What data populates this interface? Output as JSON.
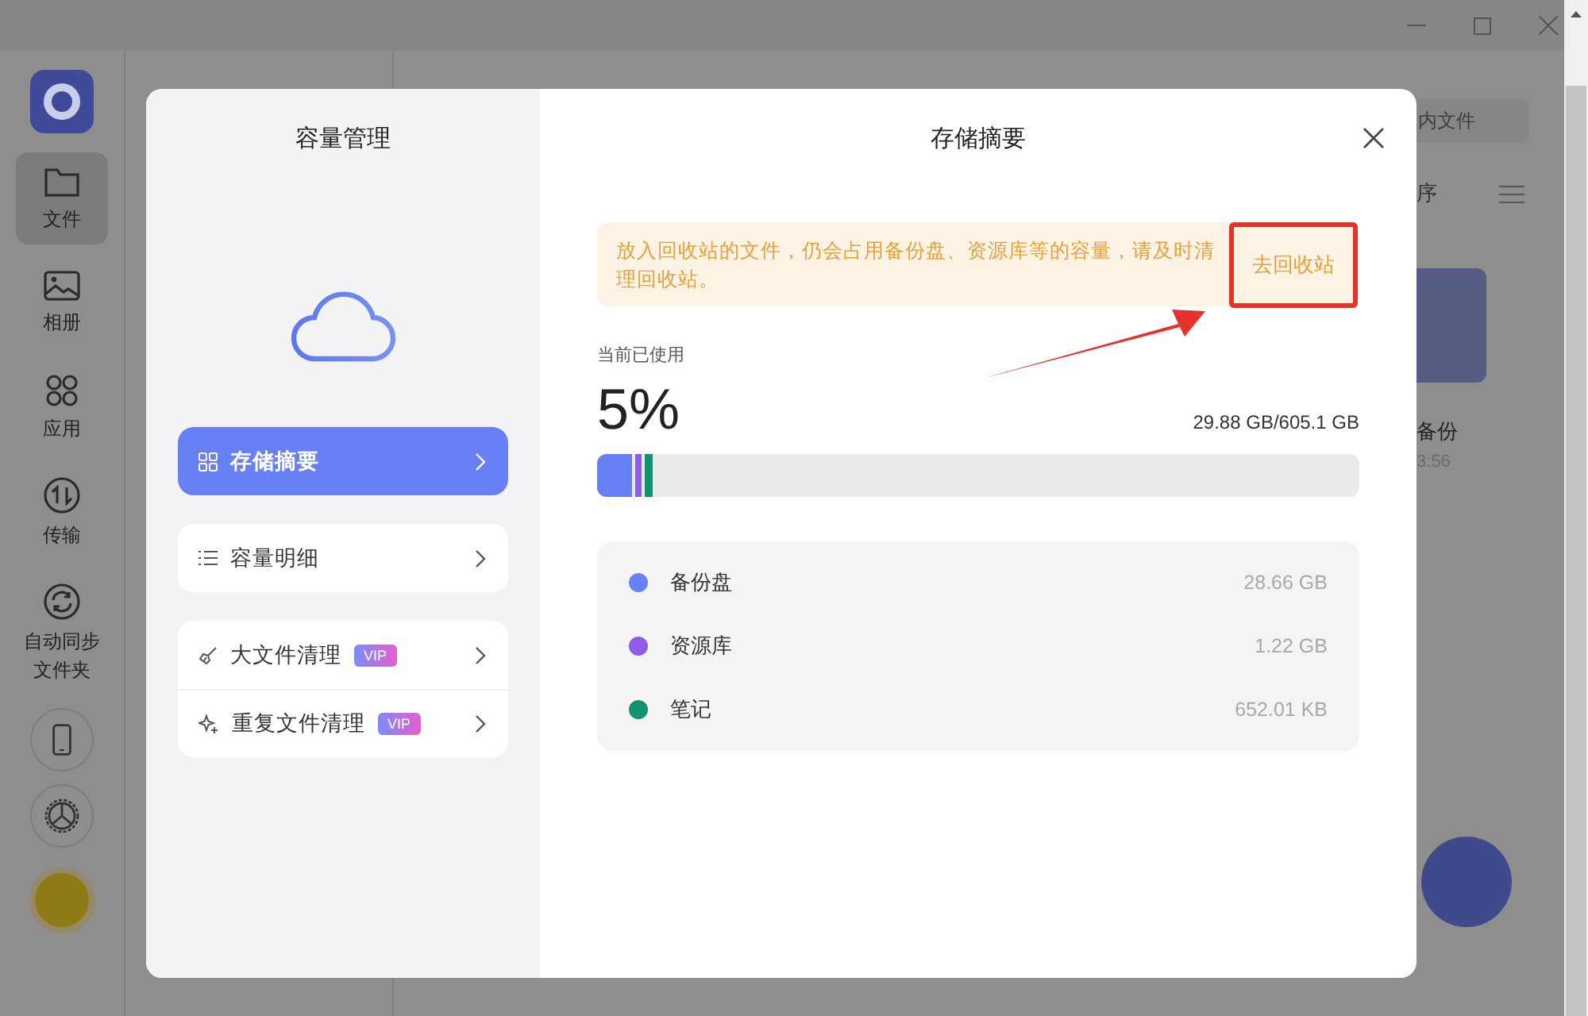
{
  "nav_rail": {
    "items": [
      {
        "label": "文件",
        "selected": true
      },
      {
        "label": "相册",
        "selected": false
      },
      {
        "label": "应用",
        "selected": false
      },
      {
        "label": "传输",
        "selected": false
      },
      {
        "label": "自动同步文件夹",
        "selected": false
      }
    ]
  },
  "background": {
    "search": {
      "placeholder": "内文件"
    },
    "sort_label": "序",
    "folder": {
      "name": "备份",
      "time": "3:56"
    }
  },
  "dialog": {
    "sidebar": {
      "title": "容量管理",
      "groups": [
        [
          {
            "label": "存储摘要",
            "selected": true
          }
        ],
        [
          {
            "label": "容量明细",
            "selected": false
          }
        ],
        [
          {
            "label": "大文件清理",
            "selected": false,
            "badge": "VIP"
          },
          {
            "label": "重复文件清理",
            "selected": false,
            "badge": "VIP"
          }
        ]
      ]
    },
    "title": "存储摘要",
    "notice": {
      "text": "放入回收站的文件，仍会占用备份盘、资源库等的容量，请及时清理回收站。",
      "action": "去回收站"
    },
    "usage": {
      "label": "当前已使用",
      "percent": "5%",
      "amount": "29.88 GB/605.1 GB",
      "segments": [
        {
          "level": 0.046,
          "color": "#6680f5"
        },
        {
          "level": 0.008,
          "color": "#8f5ce8"
        },
        {
          "level": 0.01,
          "color": "#13926f"
        }
      ]
    },
    "breakdown": [
      {
        "name": "备份盘",
        "size": "28.66 GB",
        "color": "#6680f5"
      },
      {
        "name": "资源库",
        "size": "1.22 GB",
        "color": "#8f5ce8"
      },
      {
        "name": "笔记",
        "size": "652.01 KB",
        "color": "#13926f"
      }
    ]
  }
}
